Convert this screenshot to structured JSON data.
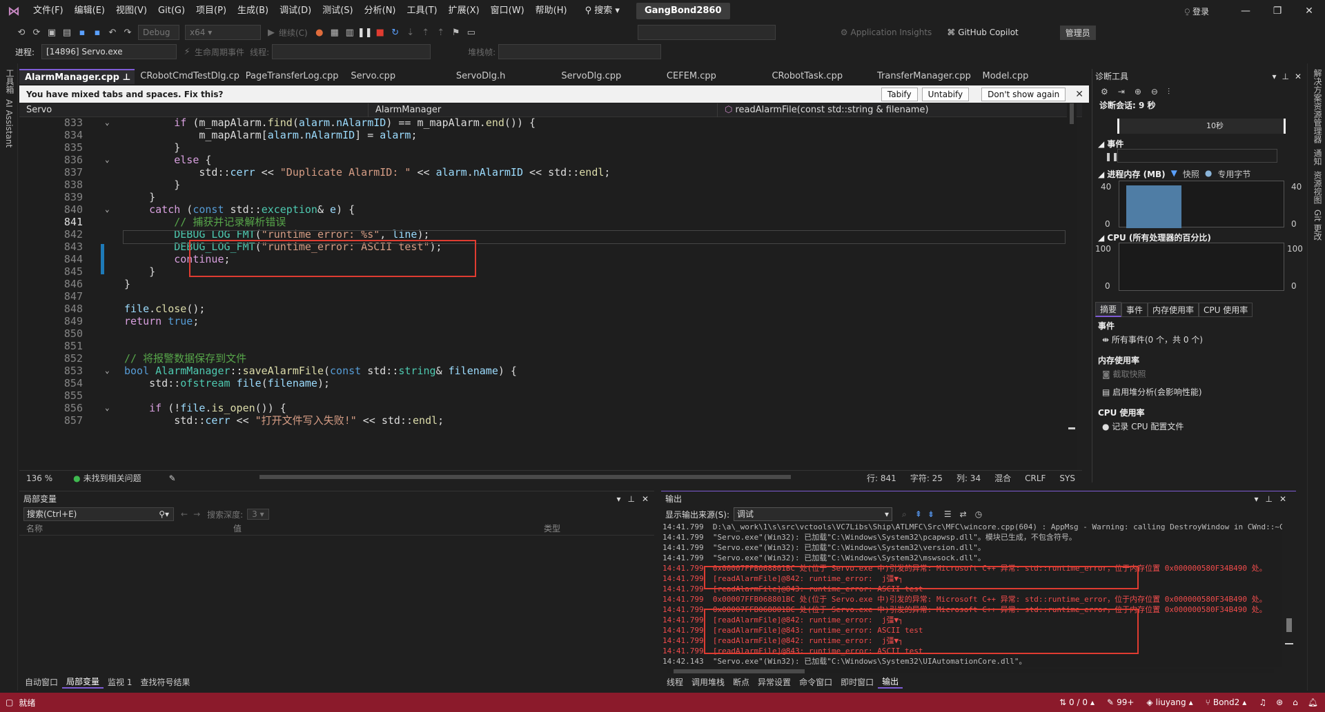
{
  "title": {
    "menus": [
      "文件(F)",
      "编辑(E)",
      "视图(V)",
      "Git(G)",
      "项目(P)",
      "生成(B)",
      "调试(D)",
      "测试(S)",
      "分析(N)",
      "工具(T)",
      "扩展(X)",
      "窗口(W)",
      "帮助(H)"
    ],
    "search": "搜索",
    "solution": "GangBond2860",
    "login": "登录"
  },
  "toolbar": {
    "config": "Debug",
    "platform": "x64",
    "continue": "继续(C)",
    "app_insights": "Application Insights",
    "copilot": "GitHub Copilot",
    "admin": "管理员",
    "process_label": "进程:",
    "process": "[14896] Servo.exe",
    "lifecycle": "生命周期事件",
    "thread_label": "线程:",
    "stackframe_label": "堆栈帧:"
  },
  "left_strip": {
    "toolbox": "工具箱",
    "ai": "AI Assistant"
  },
  "right_strip": [
    "解决方案资源管理器",
    "通知",
    "资源视图",
    "Git 更改"
  ],
  "tabs": [
    "AlarmManager.cpp",
    "CRobotCmdTestDlg.cpp",
    "PageTransferLog.cpp",
    "Servo.cpp",
    "ServoDlg.h",
    "ServoDlg.cpp",
    "CEFEM.cpp",
    "CRobotTask.cpp",
    "TransferManager.cpp",
    "Model.cpp"
  ],
  "infobar": {
    "message": "You have mixed tabs and spaces. Fix this?",
    "tabify": "Tabify",
    "untabify": "Untabify",
    "dont_show": "Don't show again"
  },
  "nav": {
    "project": "Servo",
    "class": "AlarmManager",
    "member": "readAlarmFile(const std::string & filename)"
  },
  "code": [
    {
      "n": "833",
      "fold": "⌄",
      "html": "        <span class='ctrl'>if</span> (m_mapAlarm.<span class='fn'>find</span>(<span class='var'>alarm</span>.<span class='var'>nAlarmID</span>) == m_mapAlarm.<span class='fn'>end</span>()) {"
    },
    {
      "n": "834",
      "fold": "",
      "html": "            m_mapAlarm[<span class='var'>alarm</span>.<span class='var'>nAlarmID</span>] = <span class='var'>alarm</span>;"
    },
    {
      "n": "835",
      "fold": "",
      "html": "        }"
    },
    {
      "n": "836",
      "fold": "⌄",
      "html": "        <span class='ctrl'>else</span> {"
    },
    {
      "n": "837",
      "fold": "",
      "html": "            std::<span class='var'>cerr</span> &lt;&lt; <span class='str'>\"Duplicate AlarmID: \"</span> &lt;&lt; <span class='var'>alarm</span>.<span class='var'>nAlarmID</span> &lt;&lt; std::<span class='fn'>endl</span>;"
    },
    {
      "n": "838",
      "fold": "",
      "html": "        }"
    },
    {
      "n": "839",
      "fold": "",
      "html": "    }"
    },
    {
      "n": "840",
      "fold": "⌄",
      "html": "    <span class='ctrl'>catch</span> (<span class='kw'>const</span> std::<span class='ty'>exception</span>&amp; <span class='var'>e</span>) {"
    },
    {
      "n": "841",
      "fold": "",
      "html": "        <span class='cm'>// 捕获并记录解析错误</span>"
    },
    {
      "n": "842",
      "fold": "",
      "html": "        <span class='ty'>DEBUG_LOG_FMT</span>(<span class='str'>\"runtime_error: %s\"</span>, <span class='var'>line</span>);"
    },
    {
      "n": "843",
      "fold": "",
      "html": "        <span class='ty'>DEBUG_LOG_FMT</span>(<span class='str'>\"runtime_error: ASCII test\"</span>);"
    },
    {
      "n": "844",
      "fold": "",
      "html": "        <span class='ctrl'>continue</span>;"
    },
    {
      "n": "845",
      "fold": "",
      "html": "    }"
    },
    {
      "n": "846",
      "fold": "",
      "html": "}"
    },
    {
      "n": "847",
      "fold": "",
      "html": ""
    },
    {
      "n": "848",
      "fold": "",
      "html": "<span class='var'>file</span>.<span class='fn'>close</span>();"
    },
    {
      "n": "849",
      "fold": "",
      "html": "<span class='ctrl'>return</span> <span class='kw'>true</span>;"
    },
    {
      "n": "850",
      "fold": "",
      "html": ""
    },
    {
      "n": "851",
      "fold": "",
      "html": ""
    },
    {
      "n": "852",
      "fold": "",
      "html": "<span class='cm'>// 将报警数据保存到文件</span>"
    },
    {
      "n": "853",
      "fold": "⌄",
      "html": "<span class='kw'>bool</span> <span class='ty'>AlarmManager</span>::<span class='fn'>saveAlarmFile</span>(<span class='kw'>const</span> std::<span class='ty'>string</span>&amp; <span class='var'>filename</span>) {"
    },
    {
      "n": "854",
      "fold": "",
      "html": "    std::<span class='ty'>ofstream</span> <span class='var'>file</span>(<span class='var'>filename</span>);"
    },
    {
      "n": "855",
      "fold": "",
      "html": ""
    },
    {
      "n": "856",
      "fold": "⌄",
      "html": "    <span class='ctrl'>if</span> (!<span class='var'>file</span>.<span class='fn'>is_open</span>()) {"
    },
    {
      "n": "857",
      "fold": "",
      "html": "        std::<span class='var'>cerr</span> &lt;&lt; <span class='str'>\"打开文件写入失败!\"</span> &lt;&lt; std::<span class='fn'>endl</span>;"
    }
  ],
  "editor_status": {
    "zoom": "136 %",
    "issues": "未找到相关问题",
    "line": "行: 841",
    "char": "字符: 25",
    "col": "列: 34",
    "mixed": "混合",
    "eol": "CRLF",
    "sys": "SYS"
  },
  "diag": {
    "title": "诊断工具",
    "session": "诊断会话: 9 秒",
    "timeline": "10秒",
    "events": "事件",
    "memory": "进程内存 (MB)",
    "snapshot": "快照",
    "private_bytes": "专用字节",
    "mem_max": "40",
    "mem_min": "0",
    "cpu": "CPU (所有处理器的百分比)",
    "cpu_max": "100",
    "cpu_min": "0",
    "tabs": [
      "摘要",
      "事件",
      "内存使用率",
      "CPU 使用率"
    ],
    "s_events": "事件",
    "all_events": "所有事件(0 个，共 0 个)",
    "s_memory": "内存使用率",
    "take_snapshot": "截取快照",
    "heap": "启用堆分析(会影响性能)",
    "s_cpu": "CPU 使用率",
    "record_cpu": "记录 CPU 配置文件"
  },
  "locals": {
    "title": "局部变量",
    "search": "搜索(Ctrl+E)",
    "depth": "搜索深度:",
    "depth_val": "3",
    "col_name": "名称",
    "col_value": "值",
    "col_type": "类型",
    "tabs": [
      "自动窗口",
      "局部变量",
      "监视 1",
      "查找符号结果"
    ]
  },
  "output": {
    "title": "输出",
    "source_label": "显示输出来源(S):",
    "source": "调试",
    "lines": [
      {
        "t": "14:41.799  D:\\a\\_work\\1\\s\\src\\vctools\\VC7Libs\\Ship\\ATLMFC\\Src\\MFC\\wincore.cpp(604) : AppMsg - Warning: calling DestroyWindow in CWnd::~CWnd; OnDestroy",
        "red": false
      },
      {
        "t": "14:41.799  \"Servo.exe\"(Win32): 已加载\"C:\\Windows\\System32\\pcapwsp.dll\"。模块已生成，不包含符号。",
        "red": false
      },
      {
        "t": "14:41.799  \"Servo.exe\"(Win32): 已加载\"C:\\Windows\\System32\\version.dll\"。",
        "red": false
      },
      {
        "t": "14:41.799  \"Servo.exe\"(Win32): 已加载\"C:\\Windows\\System32\\mswsock.dll\"。",
        "red": false
      },
      {
        "t": "14:41.799  0x00007FFB068801BC 处(位于 Servo.exe 中)引发的异常: Microsoft C++ 异常: std::runtime_error，位于内存位置 0x000000580F34B490 处。",
        "red": true
      },
      {
        "t": "14:41.799  [readAlarmFile]@842: runtime_error:  j彊▼┐",
        "red": true
      },
      {
        "t": "14:41.799  [readAlarmFile]@843: runtime_error: ASCII test",
        "red": true
      },
      {
        "t": "14:41.799  0x00007FFB068801BC 处(位于 Servo.exe 中)引发的异常: Microsoft C++ 异常: std::runtime_error，位于内存位置 0x000000580F34B490 处。",
        "red": true
      },
      {
        "t": "14:41.799  0x00007FFB068801BC 处(位于 Servo.exe 中)引发的异常: Microsoft C++ 异常: std::runtime_error，位于内存位置 0x000000580F34B490 处。",
        "red": true
      },
      {
        "t": "14:41.799  [readAlarmFile]@842: runtime_error:  j彊▼┐",
        "red": true
      },
      {
        "t": "14:41.799  [readAlarmFile]@843: runtime_error: ASCII test",
        "red": true
      },
      {
        "t": "14:41.799  [readAlarmFile]@842: runtime_error:  j彊▼┐",
        "red": true
      },
      {
        "t": "14:41.799  [readAlarmFile]@843: runtime_error: ASCII test",
        "red": true
      },
      {
        "t": "14:42.143  \"Servo.exe\"(Win32): 已加载\"C:\\Windows\\System32\\UIAutomationCore.dll\"。",
        "red": false
      }
    ],
    "tabs": [
      "线程",
      "调用堆栈",
      "断点",
      "异常设置",
      "命令窗口",
      "即时窗口",
      "输出"
    ]
  },
  "status": {
    "ready": "就绪",
    "changes": "0 / 0",
    "edits": "99+",
    "user": "liuyang",
    "branch": "Bond2"
  },
  "colors": {
    "accent": "#7f5cd6",
    "status_bg": "#8b1a2b",
    "highlight": "#e03c31"
  }
}
